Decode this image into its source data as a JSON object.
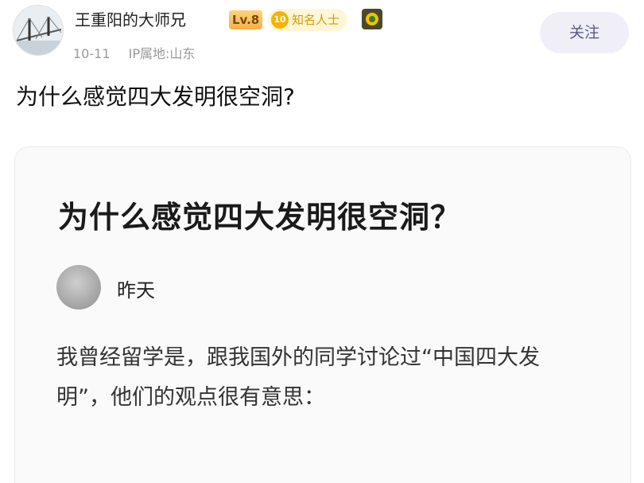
{
  "author": {
    "name": "王重阳的大师兄",
    "level": "Lv.8",
    "title_badge": {
      "number": "10",
      "label": "知名人士"
    },
    "follow_label": "关注"
  },
  "meta": {
    "date": "10-11",
    "ip_location": "IP属地:山东"
  },
  "post": {
    "title": "为什么感觉四大发明很空洞?"
  },
  "card": {
    "title": "为什么感觉四大发明很空洞？",
    "author": "昨天",
    "body": "我曾经留学是，跟我国外的同学讨论过“中国四大发明”，他们的观点很有意思："
  },
  "colors": {
    "level_badge": "#f7b24a",
    "famous_badge": "#f4b400",
    "follow_bg": "#f0eff8",
    "follow_text": "#5a5a8a"
  }
}
